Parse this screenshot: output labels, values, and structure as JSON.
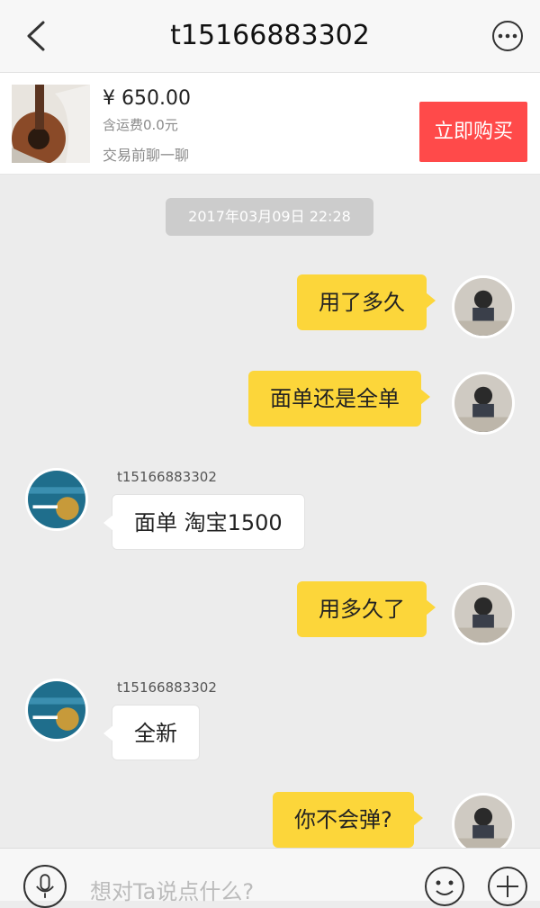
{
  "header": {
    "title": "t15166883302"
  },
  "item": {
    "price": "¥ 650.00",
    "shipping": "含运费0.0元",
    "prechat": "交易前聊一聊",
    "buy_label": "立即购买"
  },
  "chat": {
    "timestamp": "2017年03月09日 22:28",
    "messages": [
      {
        "from": "me",
        "text": "用了多久"
      },
      {
        "from": "me",
        "text": "面单还是全单"
      },
      {
        "from": "them",
        "sender": "t15166883302",
        "text": "面单 淘宝1500"
      },
      {
        "from": "me",
        "text": "用多久了"
      },
      {
        "from": "them",
        "sender": "t15166883302",
        "text": "全新"
      },
      {
        "from": "me",
        "text": "你不会弹?"
      }
    ]
  },
  "input": {
    "placeholder": "想对Ta说点什么?"
  },
  "colors": {
    "accent_buy": "#ff4a4a",
    "my_bubble": "#fcd63a",
    "their_bubble": "#ffffff",
    "background": "#ececec"
  }
}
